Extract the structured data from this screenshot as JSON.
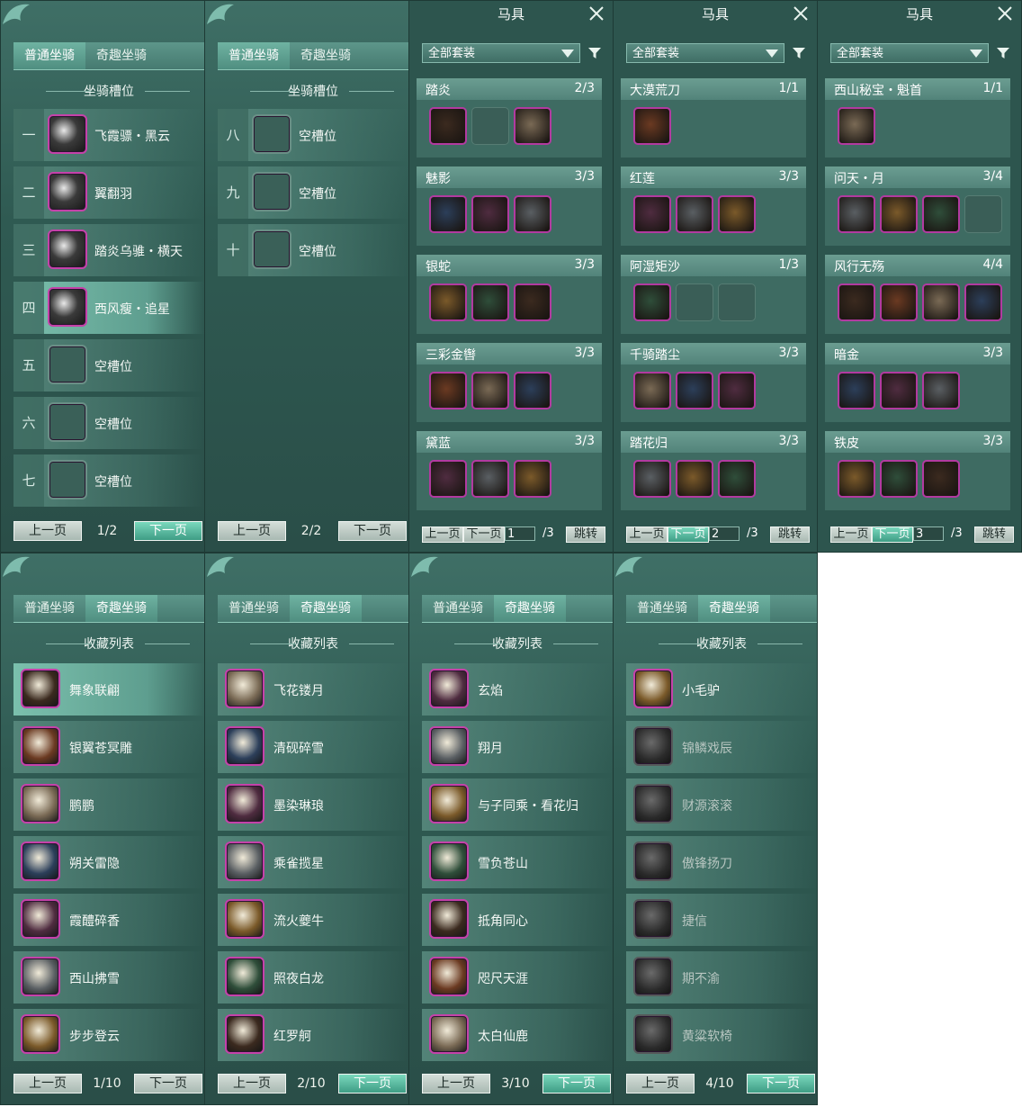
{
  "common": {
    "tab_normal": "普通坐骑",
    "tab_fun": "奇趣坐骑",
    "slots_title": "坐骑槽位",
    "collection_title": "收藏列表",
    "prev_page": "上一页",
    "next_page": "下一页",
    "suit_title": "马具",
    "suit_filter": "全部套装",
    "jump": "跳转",
    "empty_slot": "空槽位"
  },
  "slot_panels": [
    {
      "page": "1/2",
      "slots": [
        {
          "num": "一",
          "name": "飞霞骠・黑云",
          "filled": true
        },
        {
          "num": "二",
          "name": "翼翻羽",
          "filled": true
        },
        {
          "num": "三",
          "name": "踏炎乌骓・横天",
          "filled": true
        },
        {
          "num": "四",
          "name": "西风瘦・追星",
          "filled": true,
          "selected": true
        },
        {
          "num": "五",
          "name": "空槽位",
          "filled": false
        },
        {
          "num": "六",
          "name": "空槽位",
          "filled": false
        },
        {
          "num": "七",
          "name": "空槽位",
          "filled": false
        }
      ]
    },
    {
      "page": "2/2",
      "slots": [
        {
          "num": "八",
          "name": "空槽位",
          "filled": false
        },
        {
          "num": "九",
          "name": "空槽位",
          "filled": false
        },
        {
          "num": "十",
          "name": "空槽位",
          "filled": false
        }
      ]
    }
  ],
  "suit_panels": [
    {
      "page_input": "1",
      "total": "/3",
      "groups": [
        {
          "name": "踏炎",
          "count": "2/3",
          "items": [
            "on",
            "off",
            "on"
          ]
        },
        {
          "name": "魅影",
          "count": "3/3",
          "items": [
            "on",
            "on",
            "on"
          ]
        },
        {
          "name": "银蛇",
          "count": "3/3",
          "items": [
            "on",
            "on",
            "on"
          ]
        },
        {
          "name": "三彩金辔",
          "count": "3/3",
          "items": [
            "on",
            "on",
            "on"
          ]
        },
        {
          "name": "黛蓝",
          "count": "3/3",
          "items": [
            "on",
            "on",
            "on"
          ]
        }
      ]
    },
    {
      "page_input": "2",
      "total": "/3",
      "groups": [
        {
          "name": "大漠荒刀",
          "count": "1/1",
          "items": [
            "on"
          ]
        },
        {
          "name": "红莲",
          "count": "3/3",
          "items": [
            "on",
            "on",
            "on"
          ]
        },
        {
          "name": "阿湿矩沙",
          "count": "1/3",
          "items": [
            "on",
            "off",
            "off"
          ]
        },
        {
          "name": "千骑踏尘",
          "count": "3/3",
          "items": [
            "on",
            "on",
            "on"
          ]
        },
        {
          "name": "踏花归",
          "count": "3/3",
          "items": [
            "on",
            "on",
            "on"
          ]
        }
      ]
    },
    {
      "page_input": "3",
      "total": "/3",
      "groups": [
        {
          "name": "西山秘宝・魁首",
          "count": "1/1",
          "items": [
            "on"
          ]
        },
        {
          "name": "问天・月",
          "count": "3/4",
          "items": [
            "on",
            "on",
            "on",
            "off"
          ]
        },
        {
          "name": "风行无殇",
          "count": "4/4",
          "items": [
            "on",
            "on",
            "on",
            "on"
          ]
        },
        {
          "name": "暗金",
          "count": "3/3",
          "items": [
            "on",
            "on",
            "on"
          ]
        },
        {
          "name": "铁皮",
          "count": "3/3",
          "items": [
            "on",
            "on",
            "on"
          ]
        }
      ]
    }
  ],
  "collection_panels": [
    {
      "page": "1/10",
      "items": [
        {
          "name": "舞象联翩",
          "owned": true,
          "selected": true
        },
        {
          "name": "银翼苍冥雕",
          "owned": true
        },
        {
          "name": "鹏鹏",
          "owned": true
        },
        {
          "name": "朔关雷隐",
          "owned": true
        },
        {
          "name": "霞醴碎香",
          "owned": true
        },
        {
          "name": "西山拂雪",
          "owned": true
        },
        {
          "name": "步步登云",
          "owned": true
        }
      ]
    },
    {
      "page": "2/10",
      "items": [
        {
          "name": "飞花镂月",
          "owned": true
        },
        {
          "name": "清砚碎雪",
          "owned": true
        },
        {
          "name": "墨染琳琅",
          "owned": true
        },
        {
          "name": "乘雀揽星",
          "owned": true
        },
        {
          "name": "流火夔牛",
          "owned": true
        },
        {
          "name": "照夜白龙",
          "owned": true
        },
        {
          "name": "红罗舸",
          "owned": true
        }
      ]
    },
    {
      "page": "3/10",
      "items": [
        {
          "name": "玄焰",
          "owned": true
        },
        {
          "name": "翔月",
          "owned": true
        },
        {
          "name": "与子同乘・看花归",
          "owned": true
        },
        {
          "name": "雪负苍山",
          "owned": true
        },
        {
          "name": "抵角同心",
          "owned": true
        },
        {
          "name": "咫尺天涯",
          "owned": true
        },
        {
          "name": "太白仙鹿",
          "owned": true
        }
      ]
    },
    {
      "page": "4/10",
      "items": [
        {
          "name": "小毛驴",
          "owned": true
        },
        {
          "name": "锦鳞戏辰",
          "owned": false
        },
        {
          "name": "财源滚滚",
          "owned": false
        },
        {
          "name": "傲锋扬刀",
          "owned": false
        },
        {
          "name": "捷信",
          "owned": false
        },
        {
          "name": "期不渝",
          "owned": false
        },
        {
          "name": "黄粱软椅",
          "owned": false
        }
      ]
    }
  ],
  "colors": {
    "frame": "#2d554e",
    "accent": "#6fb3a2",
    "icon_border": "#c542a9",
    "btn_green": "#3e9d85"
  }
}
